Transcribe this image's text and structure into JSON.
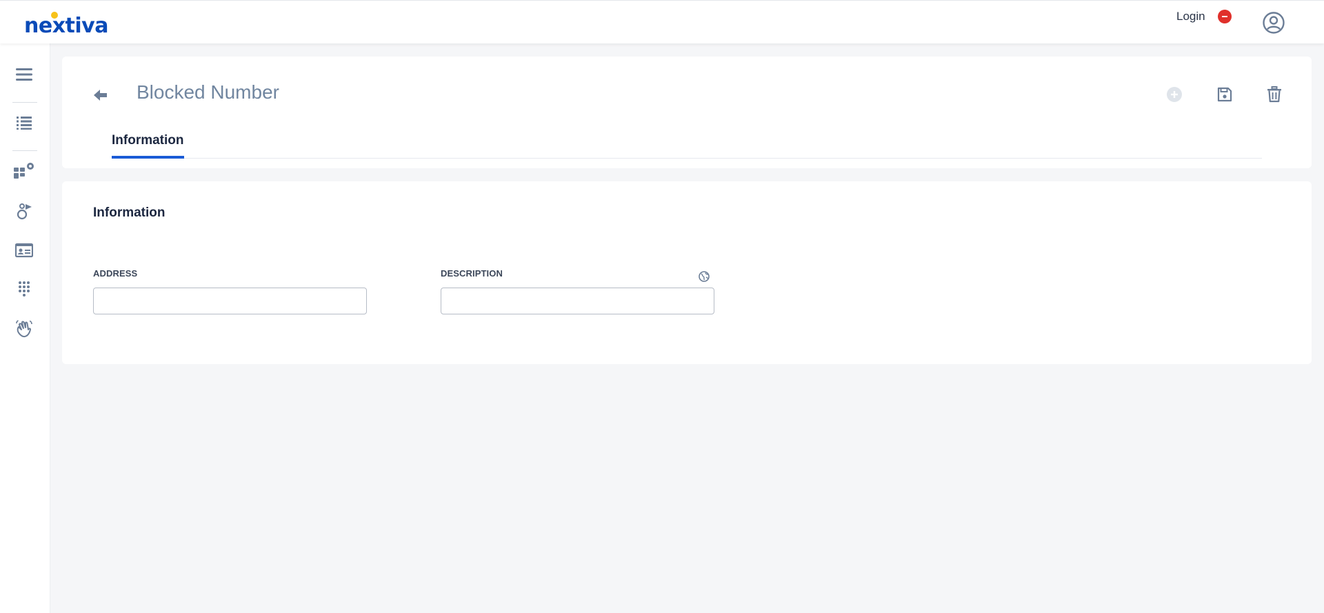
{
  "app": {
    "logo_text": "nextiva",
    "login_label": "Login"
  },
  "rail": {
    "items": [
      {
        "icon": "menu-icon"
      },
      {
        "icon": "list-icon"
      },
      {
        "icon": "apps-settings-icon"
      },
      {
        "icon": "user-routing-icon"
      },
      {
        "icon": "contact-card-icon"
      },
      {
        "icon": "dialpad-icon"
      },
      {
        "icon": "wave-hand-icon"
      }
    ]
  },
  "page": {
    "title": "Blocked Number",
    "tabs": [
      {
        "label": "Information"
      }
    ],
    "actions": [
      {
        "icon": "add-circle-icon",
        "state": "disabled"
      },
      {
        "icon": "save-icon"
      },
      {
        "icon": "trash-icon"
      }
    ]
  },
  "form": {
    "section_title": "Information",
    "fields": [
      {
        "label": "ADDRESS",
        "value": ""
      },
      {
        "label": "DESCRIPTION",
        "value": ""
      }
    ]
  },
  "colors": {
    "brand": "#0a4bb8",
    "accent": "#1a5bd6",
    "logo_dot": "#f7c21a",
    "status_red": "#e0302b",
    "icon_slate": "#6b7d96"
  }
}
